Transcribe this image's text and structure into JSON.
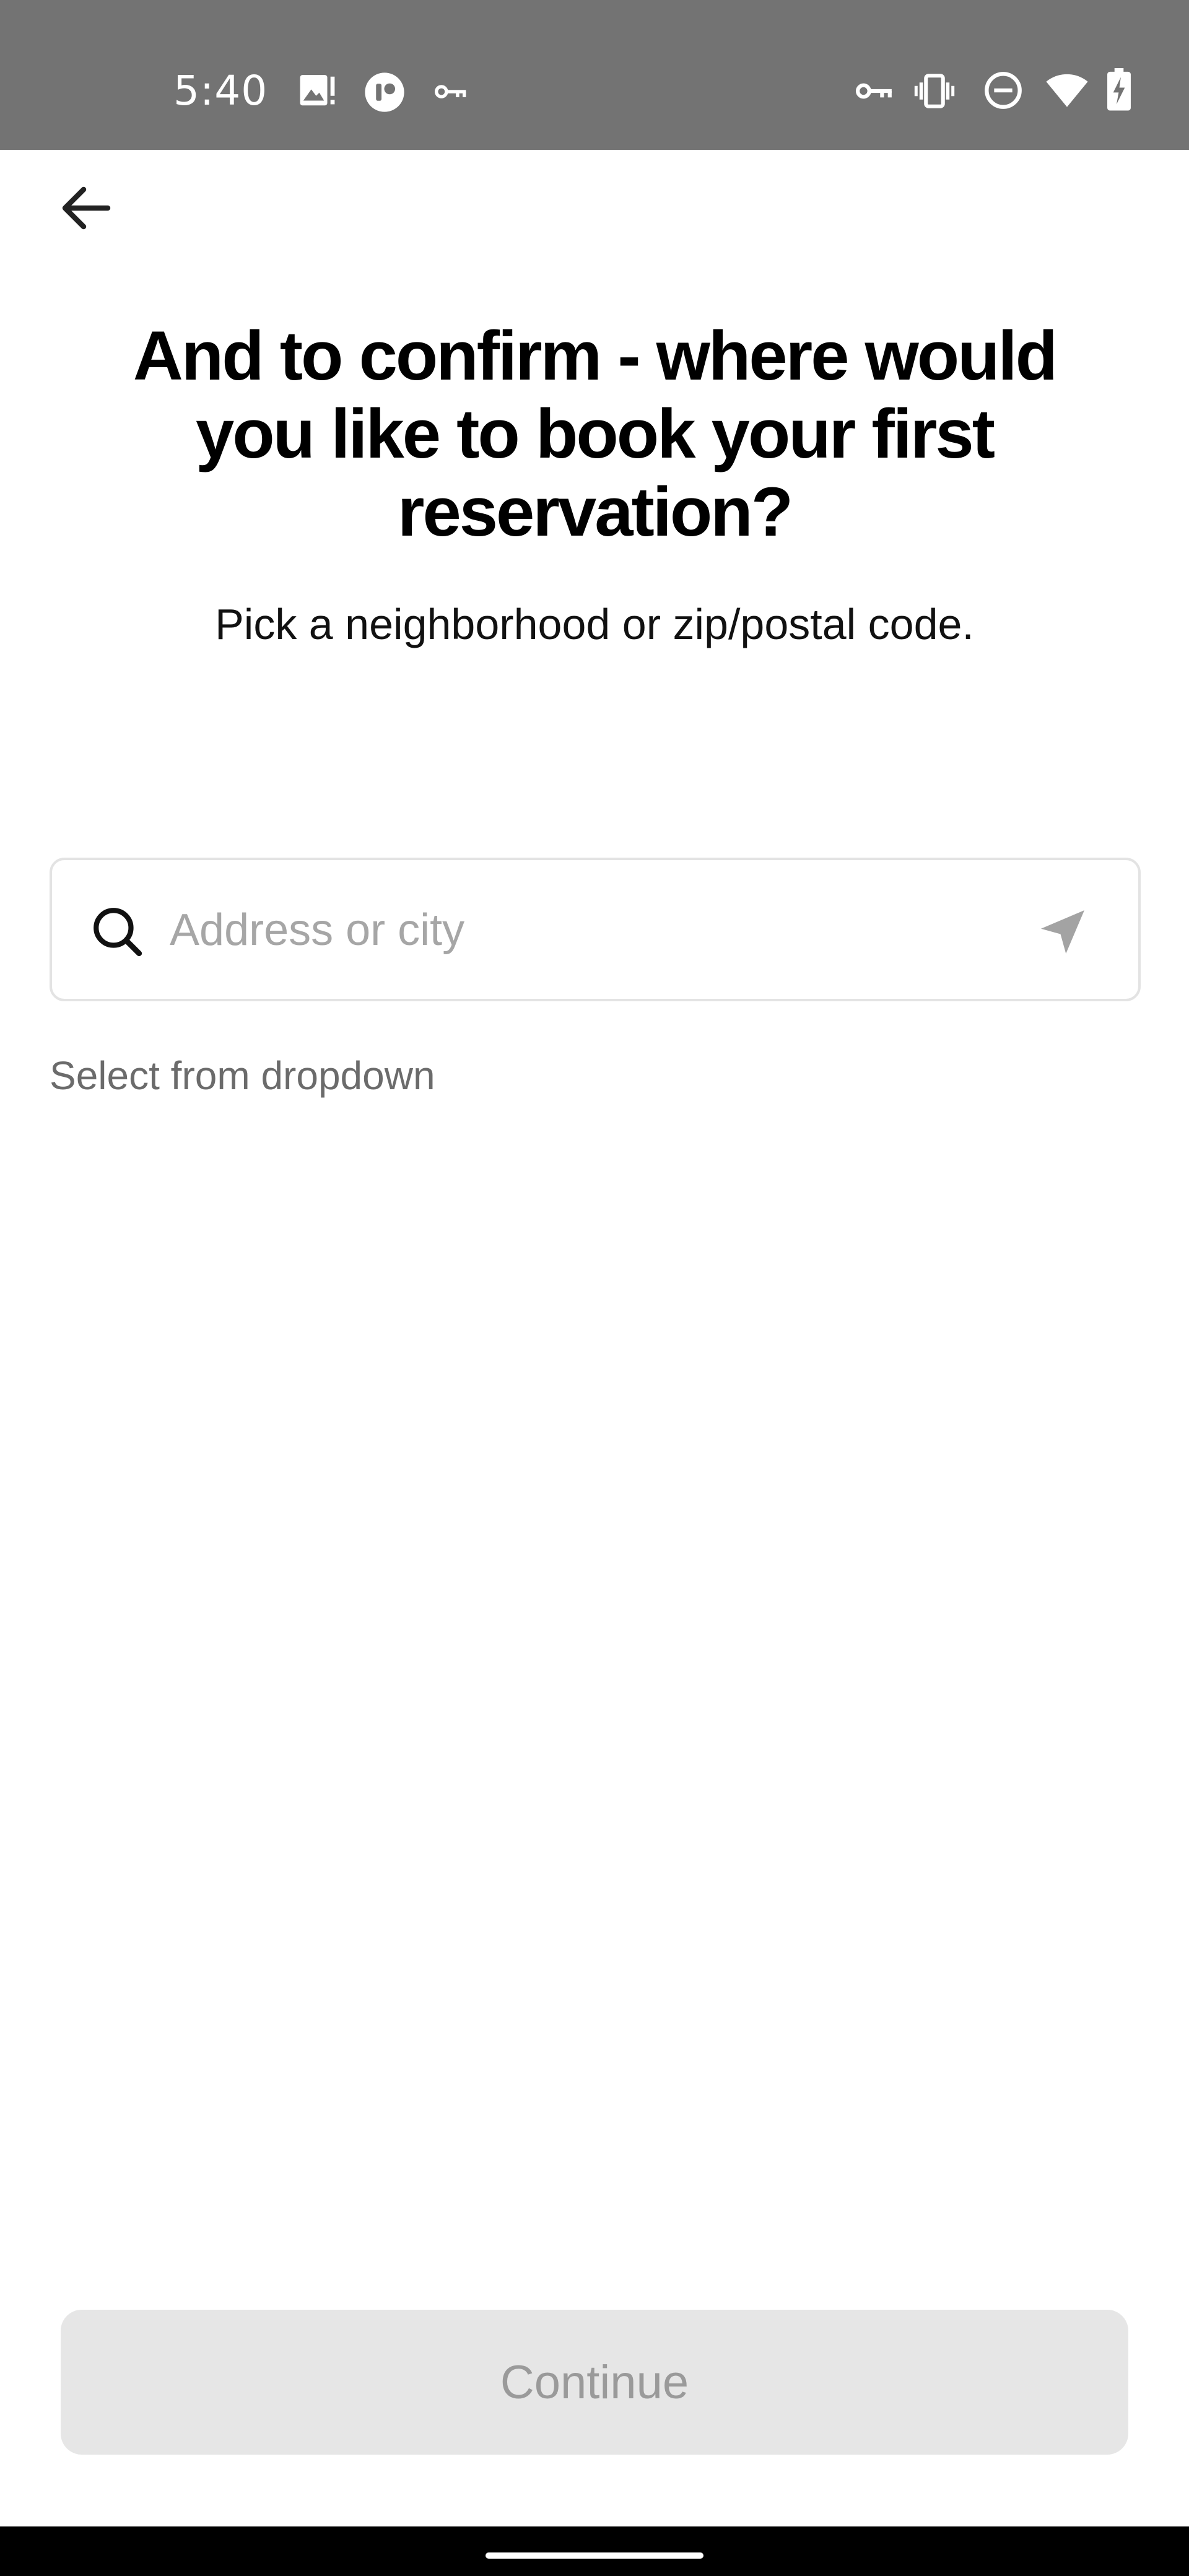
{
  "status_bar": {
    "time": "5:40",
    "left_icons": [
      "image-alert-icon",
      "app-notification-icon",
      "vpn-key-icon"
    ],
    "right_icons": [
      "vpn-key-icon",
      "vibrate-icon",
      "do-not-disturb-icon",
      "wifi-icon",
      "battery-charging-icon"
    ],
    "background": "#737373"
  },
  "header": {
    "back_icon": "arrow-left-icon",
    "title": "And to confirm - where would you like to book your first reservation?",
    "subtitle": "Pick a neighborhood or zip/postal code."
  },
  "search": {
    "icon": "search-icon",
    "value": "",
    "placeholder": "Address or city",
    "location_icon": "location-arrow-icon"
  },
  "helper": {
    "text": "Select from dropdown"
  },
  "footer": {
    "continue_label": "Continue",
    "button_color": "#e6e6e6",
    "label_color": "#9a9a9a"
  }
}
